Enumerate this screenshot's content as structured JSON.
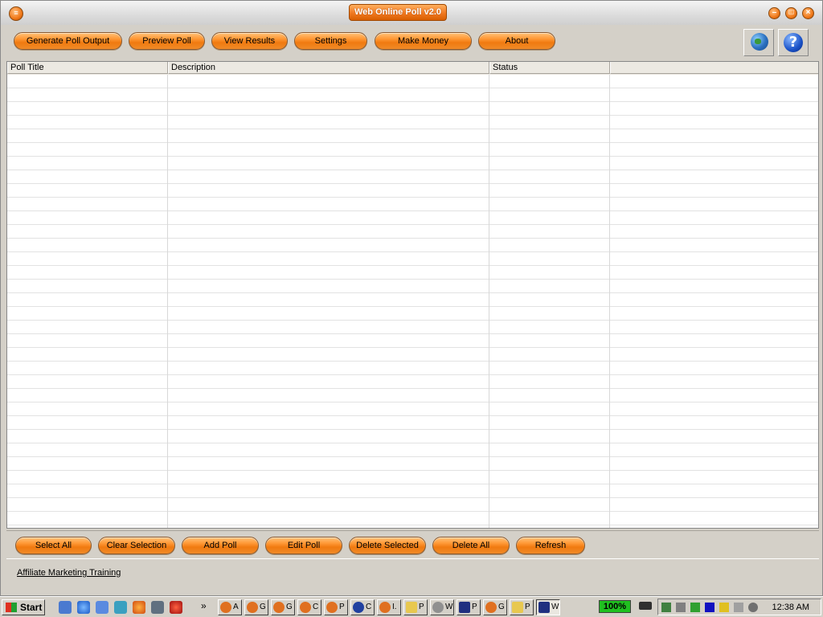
{
  "window": {
    "title": "Web Online Poll v2.0"
  },
  "toolbar": {
    "buttons": [
      "Generate Poll Output",
      "Preview Poll",
      "View Results",
      "Settings",
      "Make Money",
      "About"
    ]
  },
  "grid": {
    "columns": [
      "Poll Title",
      "Description",
      "Status",
      ""
    ],
    "rows": []
  },
  "actions": {
    "buttons": [
      "Select All",
      "Clear Selection",
      "Add Poll",
      "Edit Poll",
      "Delete Selected",
      "Delete All",
      "Refresh"
    ]
  },
  "footer": {
    "link": "Affiliate Marketing Training"
  },
  "taskbar": {
    "start_label": "Start",
    "chevron": "»",
    "tasks": [
      "A",
      "G",
      "G",
      "C",
      "P",
      "C",
      "I.",
      "P",
      "W",
      "P",
      "G",
      "P",
      "W"
    ],
    "battery": "100%",
    "clock": "12:38 AM"
  },
  "colors": {
    "accent": "#f07818",
    "window_bg": "#d4d0c8"
  }
}
